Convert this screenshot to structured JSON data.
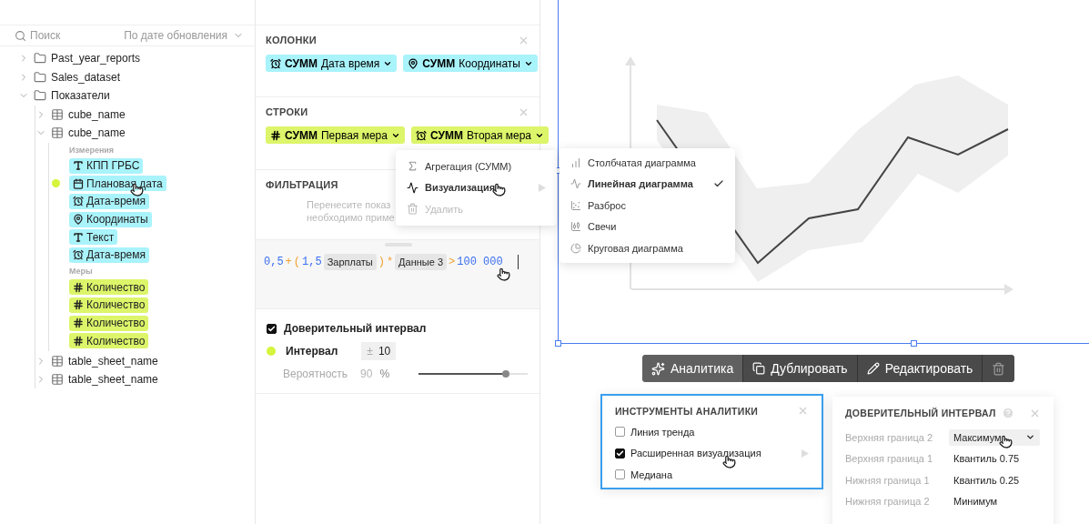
{
  "sidebar": {
    "search": {
      "placeholder": "Поиск"
    },
    "sort": "По дате обновления",
    "tree": [
      {
        "kind": "folder",
        "label": "Past_year_reports",
        "expanded": false
      },
      {
        "kind": "folder",
        "label": "Sales_dataset",
        "expanded": false
      },
      {
        "kind": "folder",
        "label": "Показатели",
        "expanded": true,
        "children": [
          {
            "kind": "table",
            "label": "cube_name",
            "expanded": false
          },
          {
            "kind": "table",
            "label": "cube_name",
            "expanded": true,
            "groups": [
              {
                "kind": "dimension",
                "title": "Измерения",
                "fields": [
                  {
                    "kind": "text",
                    "label": "КПП ГРБС",
                    "marked": false
                  },
                  {
                    "kind": "date",
                    "label": "Плановая дата",
                    "marked": true
                  },
                  {
                    "kind": "datetime",
                    "label": "Дата-время",
                    "marked": false
                  },
                  {
                    "kind": "geo",
                    "label": "Координаты",
                    "marked": false
                  },
                  {
                    "kind": "text",
                    "label": "Текст",
                    "marked": false
                  },
                  {
                    "kind": "datetime",
                    "label": "Дата-время",
                    "marked": false
                  }
                ]
              },
              {
                "kind": "measure",
                "title": "Меры",
                "fields": [
                  {
                    "kind": "number",
                    "label": "Количество",
                    "marked": false
                  },
                  {
                    "kind": "number",
                    "label": "Количество",
                    "marked": false
                  },
                  {
                    "kind": "number",
                    "label": "Количество",
                    "marked": false
                  },
                  {
                    "kind": "number",
                    "label": "Количество",
                    "marked": false
                  }
                ]
              }
            ]
          },
          {
            "kind": "table",
            "label": "table_sheet_name",
            "expanded": false
          },
          {
            "kind": "table",
            "label": "table_sheet_name",
            "expanded": false
          }
        ]
      }
    ]
  },
  "editor": {
    "sections": [
      {
        "kind": "dimension",
        "title": "КОЛОНКИ",
        "chips": [
          {
            "kind": "datetime",
            "agg": "СУММ",
            "label": "Дата время"
          },
          {
            "kind": "geo",
            "agg": "СУММ",
            "label": "Координаты"
          }
        ]
      },
      {
        "kind": "measure",
        "title": "СТРОКИ",
        "chips": [
          {
            "kind": "number",
            "agg": "СУММ",
            "label": "Первая мера"
          },
          {
            "kind": "datetime",
            "agg": "СУММ",
            "label": "Вторая мера"
          }
        ]
      }
    ],
    "filter": {
      "title": "ФИЛЬТРАЦИЯ",
      "placeholder_lines": [
        "Перенесите показ",
        "необходимо приме"
      ]
    },
    "formula": [
      {
        "kind": "number",
        "text": "0,5"
      },
      {
        "kind": "op",
        "text": "+"
      },
      {
        "kind": "op",
        "text": "("
      },
      {
        "kind": "number",
        "text": "1,5"
      },
      {
        "kind": "field",
        "text": "Зарплаты"
      },
      {
        "kind": "op",
        "text": ")"
      },
      {
        "kind": "op",
        "text": "*"
      },
      {
        "kind": "field",
        "text": "Данные 3"
      },
      {
        "kind": "op",
        "text": ">"
      },
      {
        "kind": "number",
        "text": "100 000"
      }
    ],
    "confidence": {
      "label": "Доверительный интервал",
      "checked": true,
      "interval_label": "Интервал",
      "color": "#d4f53c",
      "sign": "±",
      "value": "10",
      "probability_label": "Вероятность",
      "probability": "90",
      "unit": "%",
      "level": 0.8
    }
  },
  "context_menu": {
    "items": [
      {
        "kind": "aggregate",
        "label": "Агрегация (СУММ)",
        "selected": false,
        "disabled": false,
        "submenu": false
      },
      {
        "kind": "visual",
        "label": "Визуализация",
        "selected": true,
        "disabled": false,
        "submenu": true
      },
      {
        "kind": "delete",
        "label": "Удалить",
        "selected": false,
        "disabled": true,
        "submenu": false
      }
    ]
  },
  "chart_menu": {
    "items": [
      {
        "kind": "bar",
        "label": "Столбчатая диаграмма",
        "selected": false
      },
      {
        "kind": "line",
        "label": "Линейная диаграмма",
        "selected": true
      },
      {
        "kind": "scatter",
        "label": "Разброс",
        "selected": false
      },
      {
        "kind": "candles",
        "label": "Свечи",
        "selected": false
      },
      {
        "kind": "pie",
        "label": "Круговая диаграмма",
        "selected": false
      }
    ]
  },
  "toolbar": [
    {
      "kind": "analytics",
      "label": "Аналитика",
      "selected": true
    },
    {
      "kind": "duplicate",
      "label": "Дублировать",
      "selected": false
    },
    {
      "kind": "edit",
      "label": "Редактировать",
      "selected": false
    },
    {
      "kind": "delete",
      "selected": false
    }
  ],
  "analytics_panel": {
    "title": "ИНСТРУМЕНТЫ АНАЛИТИКИ",
    "items": [
      {
        "label": "Линия тренда",
        "checked": false,
        "submenu": false
      },
      {
        "label": "Расширенная визуализация",
        "checked": true,
        "submenu": true
      },
      {
        "label": "Медиана",
        "checked": false,
        "submenu": false
      }
    ]
  },
  "interval_panel": {
    "title": "ДОВЕРИТЕЛЬНЫЙ ИНТЕРВАЛ",
    "rows": [
      {
        "kind": "select",
        "label": "Верхняя граница 2",
        "value": "Максимум"
      },
      {
        "kind": "plain",
        "label": "Верхняя граница 1",
        "value": "Квантиль 0.75"
      },
      {
        "kind": "plain",
        "label": "Нижняя граница 1",
        "value": "Квантиль 0.25"
      },
      {
        "kind": "plain",
        "label": "Нижняя граница 2",
        "value": "Минимум"
      }
    ]
  }
}
